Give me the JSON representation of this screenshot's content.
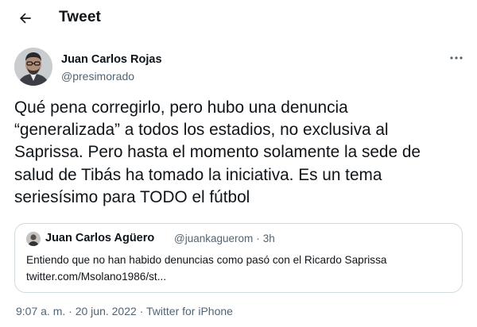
{
  "header": {
    "title": "Tweet",
    "back_icon": "arrow-left-icon"
  },
  "tweet": {
    "author_name": "Juan Carlos Rojas",
    "author_handle": "@presimorado",
    "text": "Qué pena corregirlo, pero hubo una denuncia\n“generalizada” a todos los estadios, no exclusiva al\nSaprissa. Pero hasta el momento solamente la sede de\nsalud de Tibás ha tomado la iniciativa. Es un tema\nseriesísimo para TODO el fútbol",
    "more_icon": "more-horizontal-icon"
  },
  "quote": {
    "author_name": "Juan Carlos Agüero",
    "author_handle": "@juankaguerom",
    "separator": "·",
    "time": "3h",
    "text_line1": "Entiendo que no han habido denuncias como pasó con el Ricardo Saprissa",
    "text_line2": "twitter.com/Msolano1986/st..."
  },
  "meta": {
    "time": "9:07 a. m.",
    "sep1": "·",
    "date": "20 jun. 2022",
    "sep2": "·",
    "source": "Twitter for iPhone"
  },
  "colors": {
    "text": "#0f1419",
    "secondary": "#536471",
    "border": "#cfd9de",
    "background": "#ffffff"
  }
}
